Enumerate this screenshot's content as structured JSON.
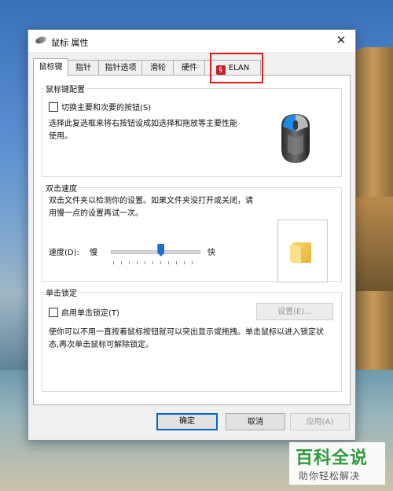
{
  "window": {
    "title": "鼠标 属性",
    "close": "✕"
  },
  "tabs": [
    {
      "label": "鼠标键",
      "active": true
    },
    {
      "label": "指针"
    },
    {
      "label": "指针选项"
    },
    {
      "label": "滑轮"
    },
    {
      "label": "硬件"
    },
    {
      "label": "ELAN",
      "icon": "elan-icon"
    }
  ],
  "button_config": {
    "legend": "鼠标键配置",
    "switch_checkbox": "切换主要和次要的按钮(S)",
    "description": "选择此复选框来将右按钮设成如选择和拖放等主要性能使用。"
  },
  "double_click": {
    "legend": "双击速度",
    "description": "双击文件夹以检测你的设置。如果文件夹没打开或关闭，请用慢一点的设置再试一次。",
    "speed_label": "速度(D):",
    "slow": "慢",
    "fast": "快",
    "speed_level_percent": 57
  },
  "click_lock": {
    "legend": "单击锁定",
    "checkbox": "启用单击锁定(T)",
    "settings_button": "设置(E)...",
    "description": "使你可以不用一直按着鼠标按钮就可以突出显示或拖拽。单击鼠标以进入锁定状态,再次单击鼠标可解除锁定。"
  },
  "footer": {
    "ok": "确定",
    "cancel": "取消",
    "apply": "应用(A)"
  },
  "watermark": {
    "big": "百科全说",
    "small": "助你轻松解决"
  },
  "colors": {
    "accent": "#0a64c8",
    "highlight": "#d81e1e",
    "elan": "#c5202a",
    "watermark": "#2e9a3c"
  }
}
